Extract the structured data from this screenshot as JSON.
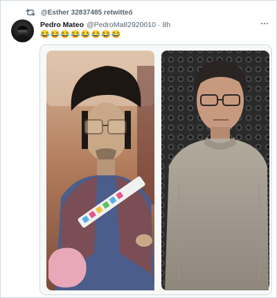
{
  "retweet": {
    "text": "@Esther 32837485 retwitteó",
    "icon": "retweet-icon"
  },
  "tweet": {
    "avatar_icon": "avatar-photo",
    "display_name": "Pedro Mateo",
    "handle": "@PedroMa82920010",
    "separator": "·",
    "time": "8h",
    "text": "😂😂😂😂😂😂😂😂"
  },
  "media": {
    "description_icons": [
      "left-photo",
      "right-photo"
    ]
  },
  "colors": {
    "secondary_text": "#536471",
    "border": "#cfd9de"
  }
}
